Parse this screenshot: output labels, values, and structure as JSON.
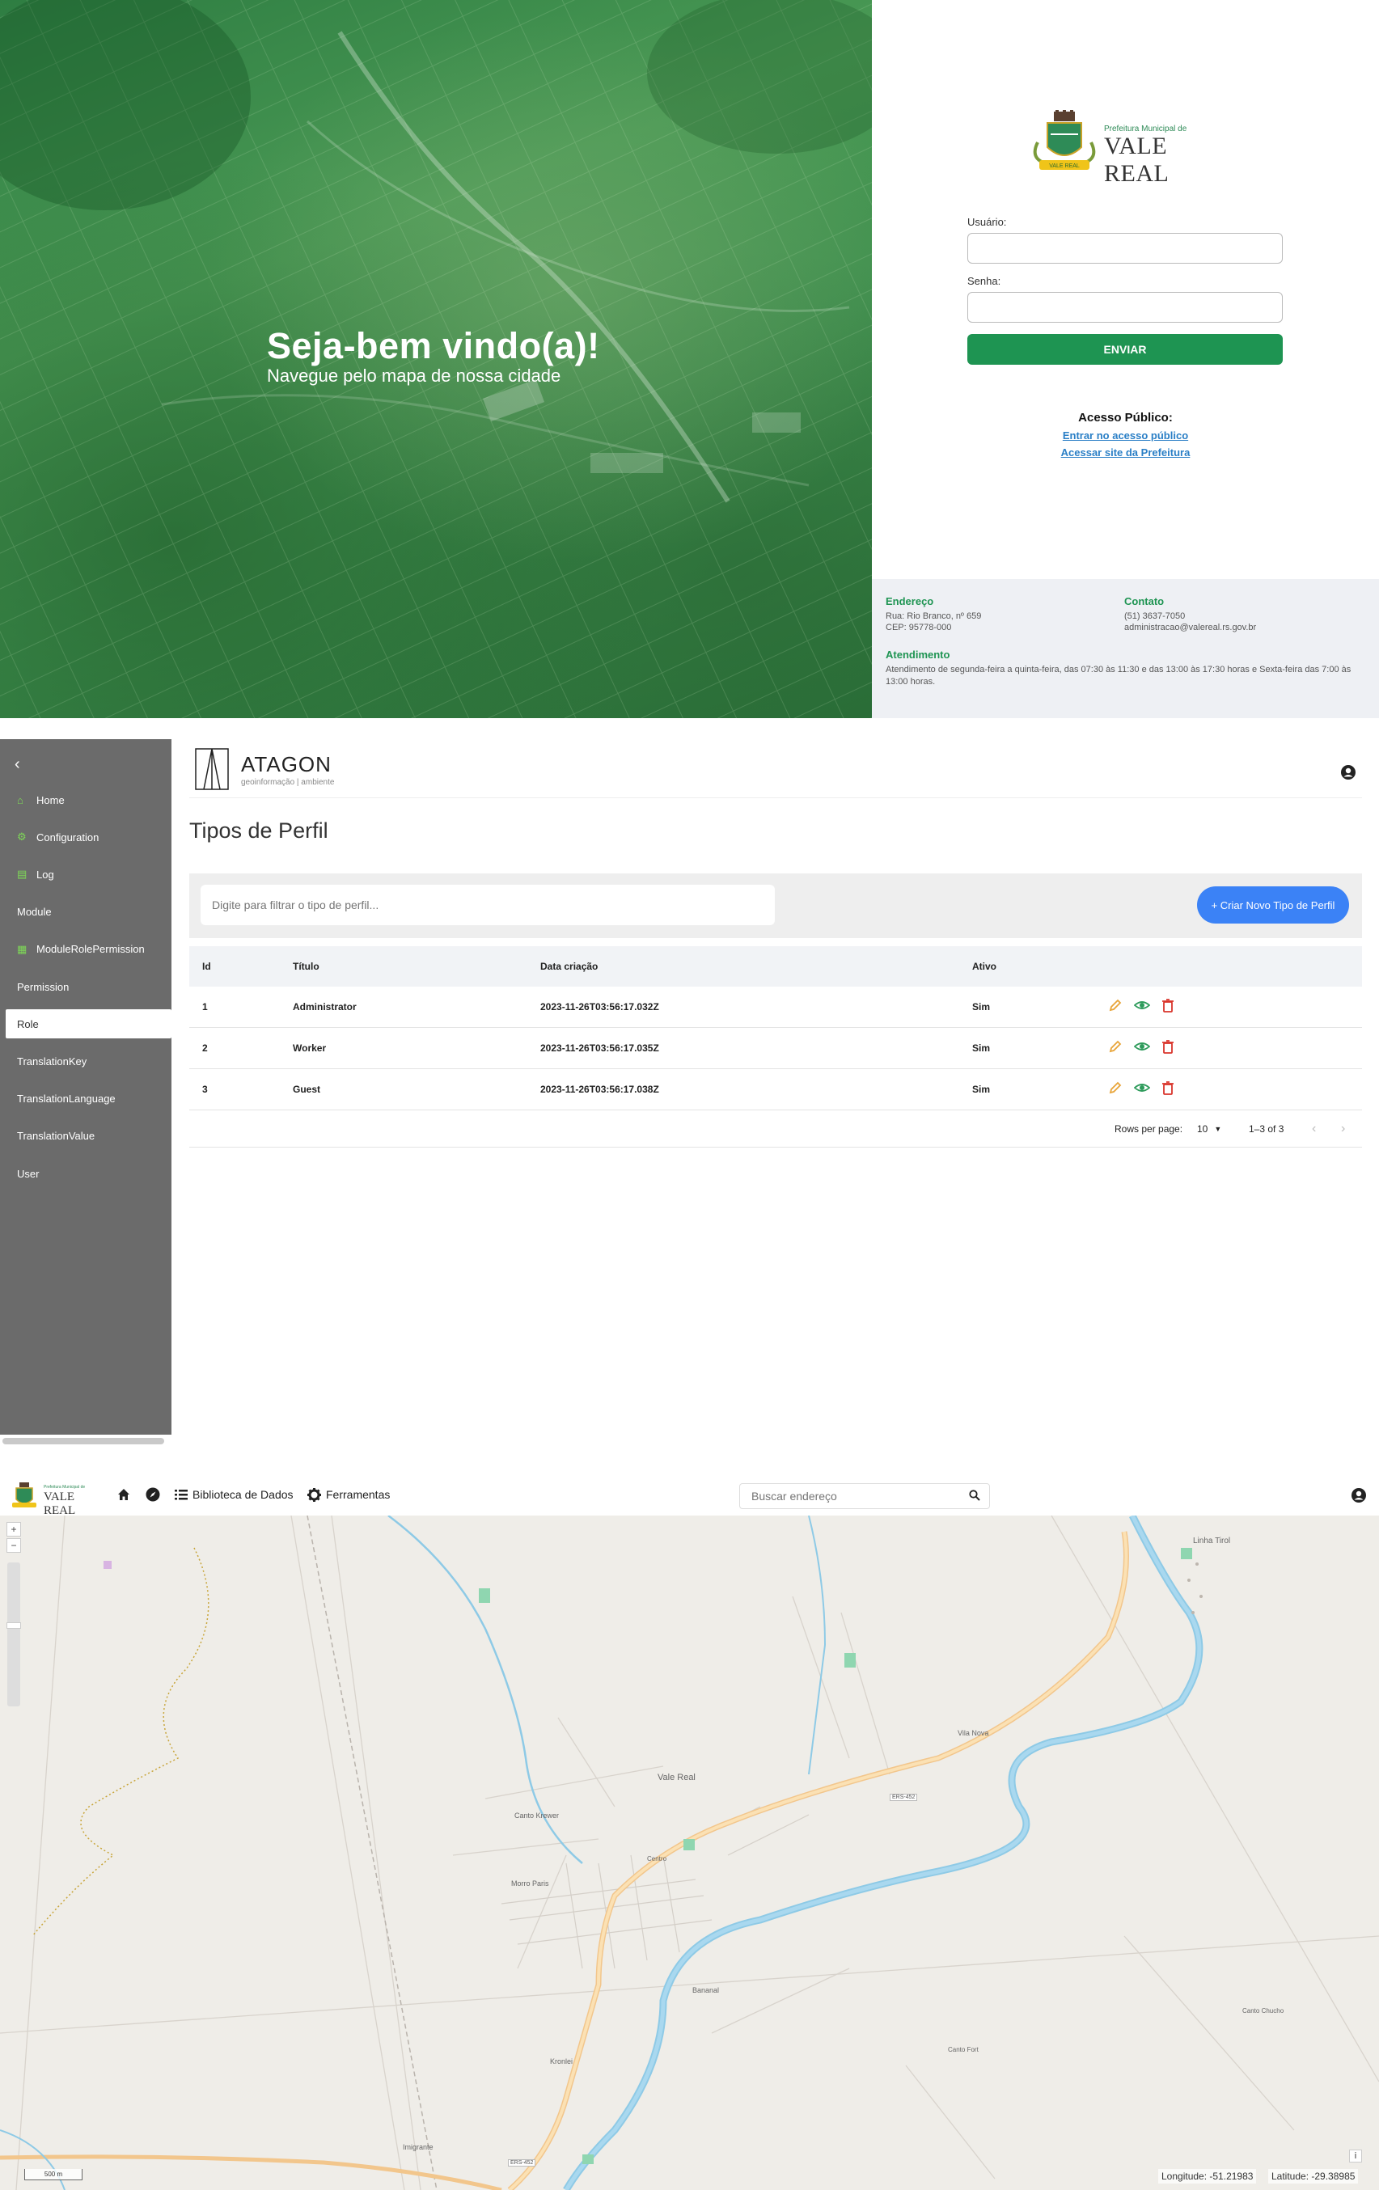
{
  "login": {
    "hero_title": "Seja-bem vindo(a)!",
    "hero_subtitle": "Navegue pelo mapa de nossa cidade",
    "logo_small": "Prefeitura Municipal de",
    "logo_big": "VALE REAL",
    "seal_banner": "VALE REAL",
    "user_label": "Usuário:",
    "user_value": "",
    "password_label": "Senha:",
    "password_value": "",
    "submit_label": "ENVIAR",
    "public_title": "Acesso Público:",
    "public_link": "Entrar no acesso público",
    "site_link": "Acessar site da Prefeitura",
    "footer": {
      "address_title": "Endereço",
      "address_line1": "Rua: Rio Branco, nº 659",
      "address_line2": "CEP: 95778-000",
      "contact_title": "Contato",
      "contact_phone": "(51) 3637-7050",
      "contact_email": "administracao@valereal.rs.gov.br",
      "hours_title": "Atendimento",
      "hours_text": "Atendimento de segunda-feira a quinta-feira, das 07:30 às 11:30 e das 13:00 às 17:30 horas e Sexta-feira das 7:00 às 13:00 horas."
    },
    "colors": {
      "primary_green": "#1e9452",
      "link_blue": "#2a7fc6"
    }
  },
  "admin": {
    "brand_name": "ATAGON",
    "brand_sub": "geoinformação | ambiente",
    "sidebar": [
      {
        "label": "Home",
        "icon": "home-icon",
        "has_icon": true
      },
      {
        "label": "Configuration",
        "icon": "gear-icon",
        "has_icon": true
      },
      {
        "label": "Log",
        "icon": "log-icon",
        "has_icon": true
      },
      {
        "label": "Module",
        "icon": "",
        "has_icon": false
      },
      {
        "label": "ModuleRolePermission",
        "icon": "grid-icon",
        "has_icon": true
      },
      {
        "label": "Permission",
        "icon": "",
        "has_icon": false
      },
      {
        "label": "Role",
        "icon": "",
        "has_icon": false,
        "active": true
      },
      {
        "label": "TranslationKey",
        "icon": "",
        "has_icon": false
      },
      {
        "label": "TranslationLanguage",
        "icon": "",
        "has_icon": false
      },
      {
        "label": "TranslationValue",
        "icon": "",
        "has_icon": false
      },
      {
        "label": "User",
        "icon": "",
        "has_icon": false
      }
    ],
    "page_title": "Tipos de Perfil",
    "filter_placeholder": "Digite para filtrar o tipo de perfil...",
    "create_button": "+ Criar Novo Tipo de Perfil",
    "table": {
      "headers": [
        "Id",
        "Título",
        "Data criação",
        "Ativo"
      ],
      "rows": [
        [
          "1",
          "Administrator",
          "2023-11-26T03:56:17.032Z",
          "Sim"
        ],
        [
          "2",
          "Worker",
          "2023-11-26T03:56:17.035Z",
          "Sim"
        ],
        [
          "3",
          "Guest",
          "2023-11-26T03:56:17.038Z",
          "Sim"
        ]
      ],
      "rows_per_page_label": "Rows per page:",
      "rows_per_page_value": "10",
      "range_label": "1–3 of 3"
    },
    "colors": {
      "sidebar_bg": "#6b6b6b",
      "accent_green": "#7ed957",
      "button_blue": "#3b82f6",
      "edit": "#e8a53a",
      "view": "#2e9b5b",
      "delete": "#d9342b"
    }
  },
  "map": {
    "logo_small": "Prefeitura Municipal de",
    "logo_big": "VALE REAL",
    "nav": {
      "library": "Biblioteca de Dados",
      "tools": "Ferramentas"
    },
    "search_placeholder": "Buscar endereço",
    "scale_label": "500 m",
    "longitude_label": "Longitude: -51.21983",
    "latitude_label": "Latitude: -29.38985",
    "labels": {
      "vale_real": "Vale Real",
      "vila_nova": "Vila Nova",
      "baixa_tirol": "Linha Tirol",
      "morro_paris": "Morro Paris",
      "canto_krewer": "Canto Krewer",
      "bananal": "Bananal",
      "kronlei": "Kronlei",
      "imigrante": "Imigrante",
      "centro": "Centro",
      "ers452": "ERS-452",
      "canto_forst": "Canto Fort",
      "canto_chucho": "Canto Chucho"
    },
    "plus": "+",
    "minus": "−",
    "info": "i"
  }
}
